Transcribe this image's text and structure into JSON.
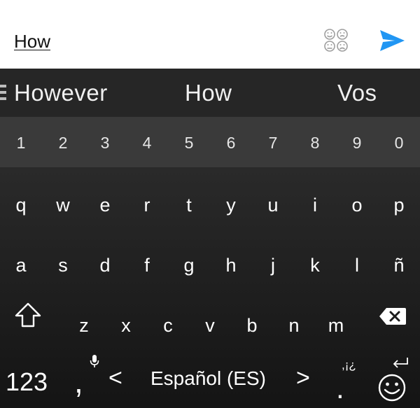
{
  "compose": {
    "text": "How",
    "emoji_icon": "emoji-faces-icon",
    "send_icon": "send-icon",
    "accent_color": "#2196f3"
  },
  "keyboard": {
    "suggestions": [
      "However",
      "How",
      "Vos"
    ],
    "number_row": [
      "1",
      "2",
      "3",
      "4",
      "5",
      "6",
      "7",
      "8",
      "9",
      "0"
    ],
    "row1": [
      "q",
      "w",
      "e",
      "r",
      "t",
      "y",
      "u",
      "i",
      "o",
      "p"
    ],
    "row2": [
      "a",
      "s",
      "d",
      "f",
      "g",
      "h",
      "j",
      "k",
      "l",
      "ñ"
    ],
    "row3": [
      "z",
      "x",
      "c",
      "v",
      "b",
      "n",
      "m"
    ],
    "bottom": {
      "numbers_label": "123",
      "comma_label": ",",
      "space_left_arrow": "<",
      "space_label": "Español (ES)",
      "space_right_arrow": ">",
      "period_symbols": ",¡¿",
      "period_label": "."
    },
    "background_color": "#1f1f1f",
    "number_row_color": "#3a3a3a"
  }
}
